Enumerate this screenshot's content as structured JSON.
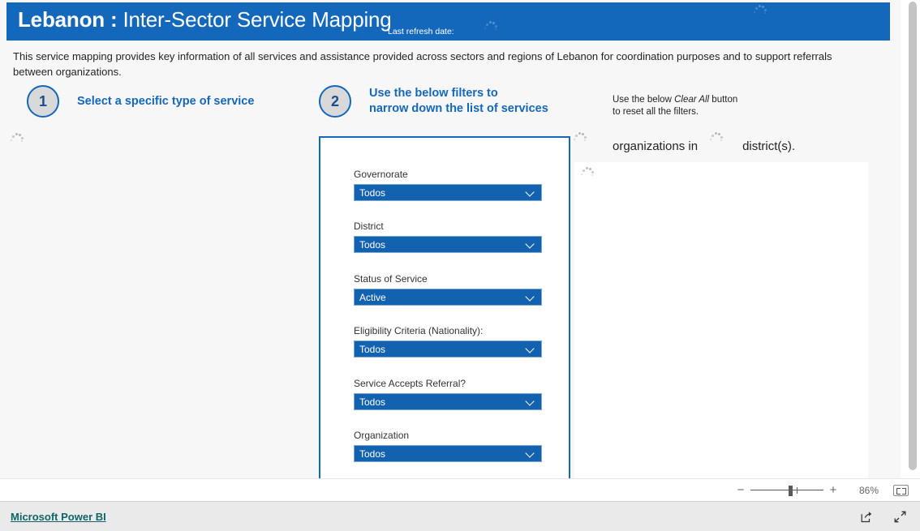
{
  "header": {
    "title_bold": "Lebanon :",
    "title_light": " Inter-Sector Service Mapping",
    "refresh_label": "Last refresh date:"
  },
  "intro": {
    "text": "This service mapping provides key information of all services and assistance provided across sectors and regions of Lebanon for coordination purposes and to support referrals between organizations."
  },
  "steps": [
    {
      "number": "1",
      "label": "Select a specific type of service"
    },
    {
      "number": "2",
      "label": "Use the below filters to\nnarrow down the list of services"
    }
  ],
  "clear_hint": {
    "before": "Use the below ",
    "emphasis": "Clear All",
    "after": " button\nto reset all the filters."
  },
  "summary": {
    "organizations_word": "organizations in",
    "districts_word": "district(s)."
  },
  "filters": [
    {
      "label": "Governorate",
      "value": "Todos"
    },
    {
      "label": "District",
      "value": "Todos"
    },
    {
      "label": "Status of Service",
      "value": "Active"
    },
    {
      "label": "Eligibility Criteria (Nationality):",
      "value": "Todos"
    },
    {
      "label": "Service Accepts Referral?",
      "value": "Todos"
    },
    {
      "label": "Organization",
      "value": "Todos"
    }
  ],
  "zoombar": {
    "minus": "−",
    "plus": "+",
    "percent": "86%"
  },
  "footer": {
    "link": "Microsoft Power BI"
  },
  "colors": {
    "brand_blue": "#1468BC",
    "select_blue": "#1362B0",
    "step_text_blue": "#1468BC",
    "footer_link": "#116466",
    "canvas_bg": "#f7f7f7"
  }
}
